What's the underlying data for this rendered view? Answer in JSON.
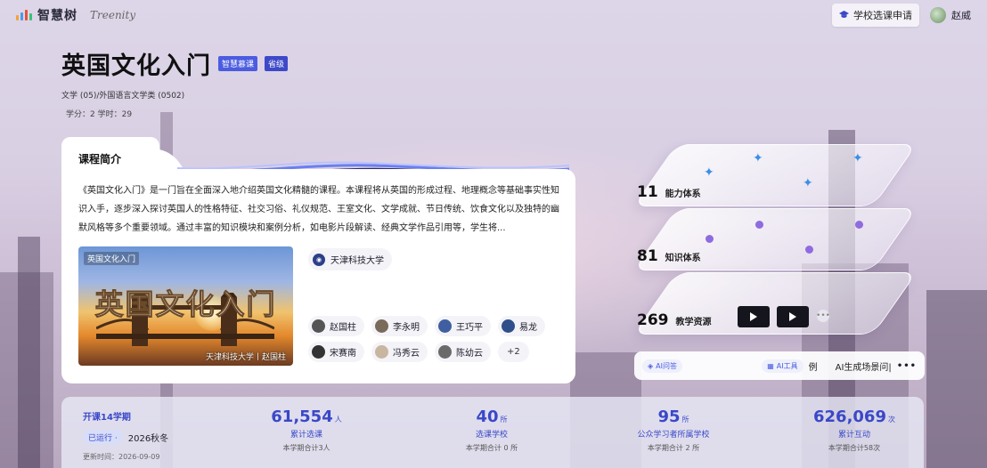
{
  "header": {
    "logo_text": "智慧树",
    "logo_en": "Treenity",
    "apply_label": "学校选课申请",
    "user_name": "赵威"
  },
  "course": {
    "title": "英国文化入门",
    "tag_mooc": "智慧慕课",
    "tag_level": "省级",
    "subject": "文学 (05)/外国语言文学类 (0502)",
    "credits": "学分：2   学时：29"
  },
  "intro": {
    "heading": "课程简介",
    "text": "《英国文化入门》是一门旨在全面深入地介绍英国文化精髓的课程。本课程将从英国的形成过程、地理概念等基础事实性知识入手，逐步深入探讨英国人的性格特征、社交习俗、礼仪规范、王室文化、文学成就、节日传统、饮食文化以及独特的幽默风格等多个重要领域。通过丰富的知识模块和案例分析，如电影片段解读、经典文学作品引用等，学生将...",
    "video_title": "英国文化入门",
    "video_logo": "英国文化入门",
    "video_caption": "天津科技大学丨赵国柱",
    "school": "天津科技大学",
    "teachers": [
      "赵国柱",
      "李永明",
      "王巧平",
      "易龙",
      "宋赛南",
      "冯秀云",
      "陈幼云"
    ],
    "more_teachers": "+2"
  },
  "stats": {
    "ability": {
      "num": "11",
      "label": "能力体系"
    },
    "knowledge": {
      "num": "81",
      "label": "知识体系"
    },
    "resources": {
      "num": "269",
      "label": "教学资源"
    }
  },
  "ai_bar": {
    "qa_label": "AI问答",
    "tool_label": "AI工具",
    "tool_suffix": "例",
    "scene_text": "AI生成场景问|",
    "more": "•••"
  },
  "bottom": {
    "term_title": "开课14学期",
    "status": "已运行 ·",
    "semester": "2026秋冬",
    "update_time": "更新时间：2026-09-09",
    "cols": [
      {
        "num": "61,554",
        "unit": "人",
        "label": "累计选课",
        "sub": "本学期合计3人"
      },
      {
        "num": "40",
        "unit": "所",
        "label": "选课学校",
        "sub": "本学期合计 0 所"
      },
      {
        "num": "95",
        "unit": "所",
        "label": "公众学习者所属学校",
        "sub": "本学期合计 2 所"
      },
      {
        "num": "626,069",
        "unit": "次",
        "label": "累计互动",
        "sub": "本学期合计58次"
      }
    ]
  },
  "colors": {
    "accent": "#3a48c8",
    "tag": "#4b5ce0",
    "sparkle": "#3a8fe8",
    "dot": "#8f6be0"
  }
}
